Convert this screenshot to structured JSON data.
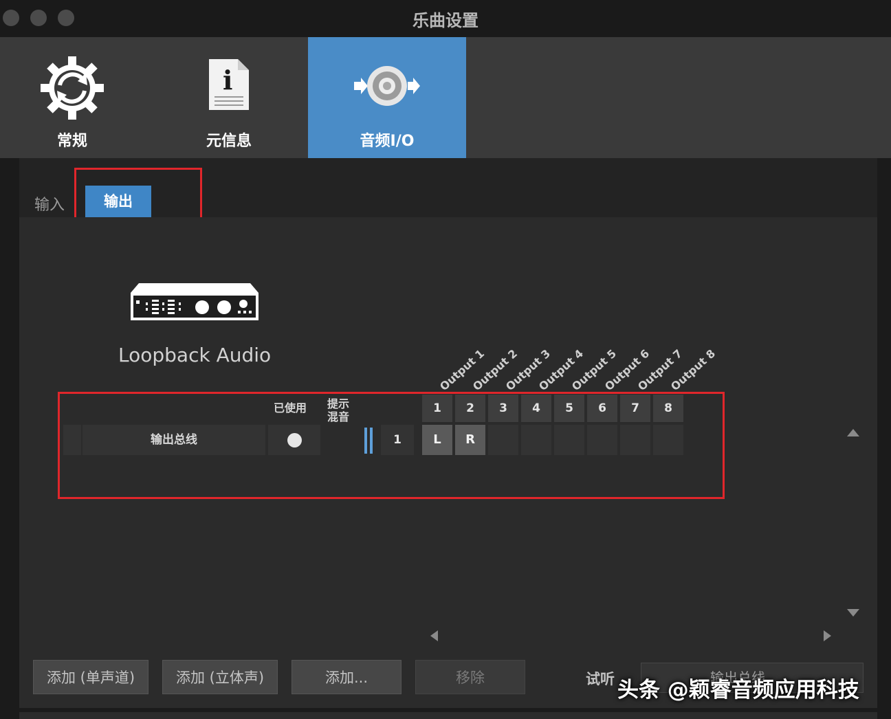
{
  "window": {
    "title": "乐曲设置"
  },
  "tabs": [
    {
      "label": "常规",
      "icon": "gear-refresh-icon"
    },
    {
      "label": "元信息",
      "icon": "info-document-icon"
    },
    {
      "label": "音频I/O",
      "icon": "speaker-io-icon",
      "active": true
    }
  ],
  "subtabs": {
    "input": "输入",
    "output": "输出"
  },
  "device": {
    "name": "Loopback Audio",
    "icon": "audio-interface-icon"
  },
  "columns": {
    "used": "已使用",
    "cue_line1": "提示",
    "cue_line2": "混音"
  },
  "outputs": [
    "Output 1",
    "Output 2",
    "Output 3",
    "Output 4",
    "Output 5",
    "Output 6",
    "Output 7",
    "Output 8"
  ],
  "channel_numbers": [
    "1",
    "2",
    "3",
    "4",
    "5",
    "6",
    "7",
    "8"
  ],
  "bus": {
    "name": "输出总线",
    "channel_count": "1",
    "left": "L",
    "right": "R"
  },
  "buttons": {
    "add_mono": "添加 (单声道)",
    "add_stereo": "添加 (立体声)",
    "add_more": "添加...",
    "remove": "移除"
  },
  "audition": {
    "label": "试听",
    "value": "输出总线"
  },
  "watermark": "头条 @颖睿音频应用科技",
  "colors": {
    "accent": "#4a8cc7",
    "highlight": "#e0262b"
  }
}
